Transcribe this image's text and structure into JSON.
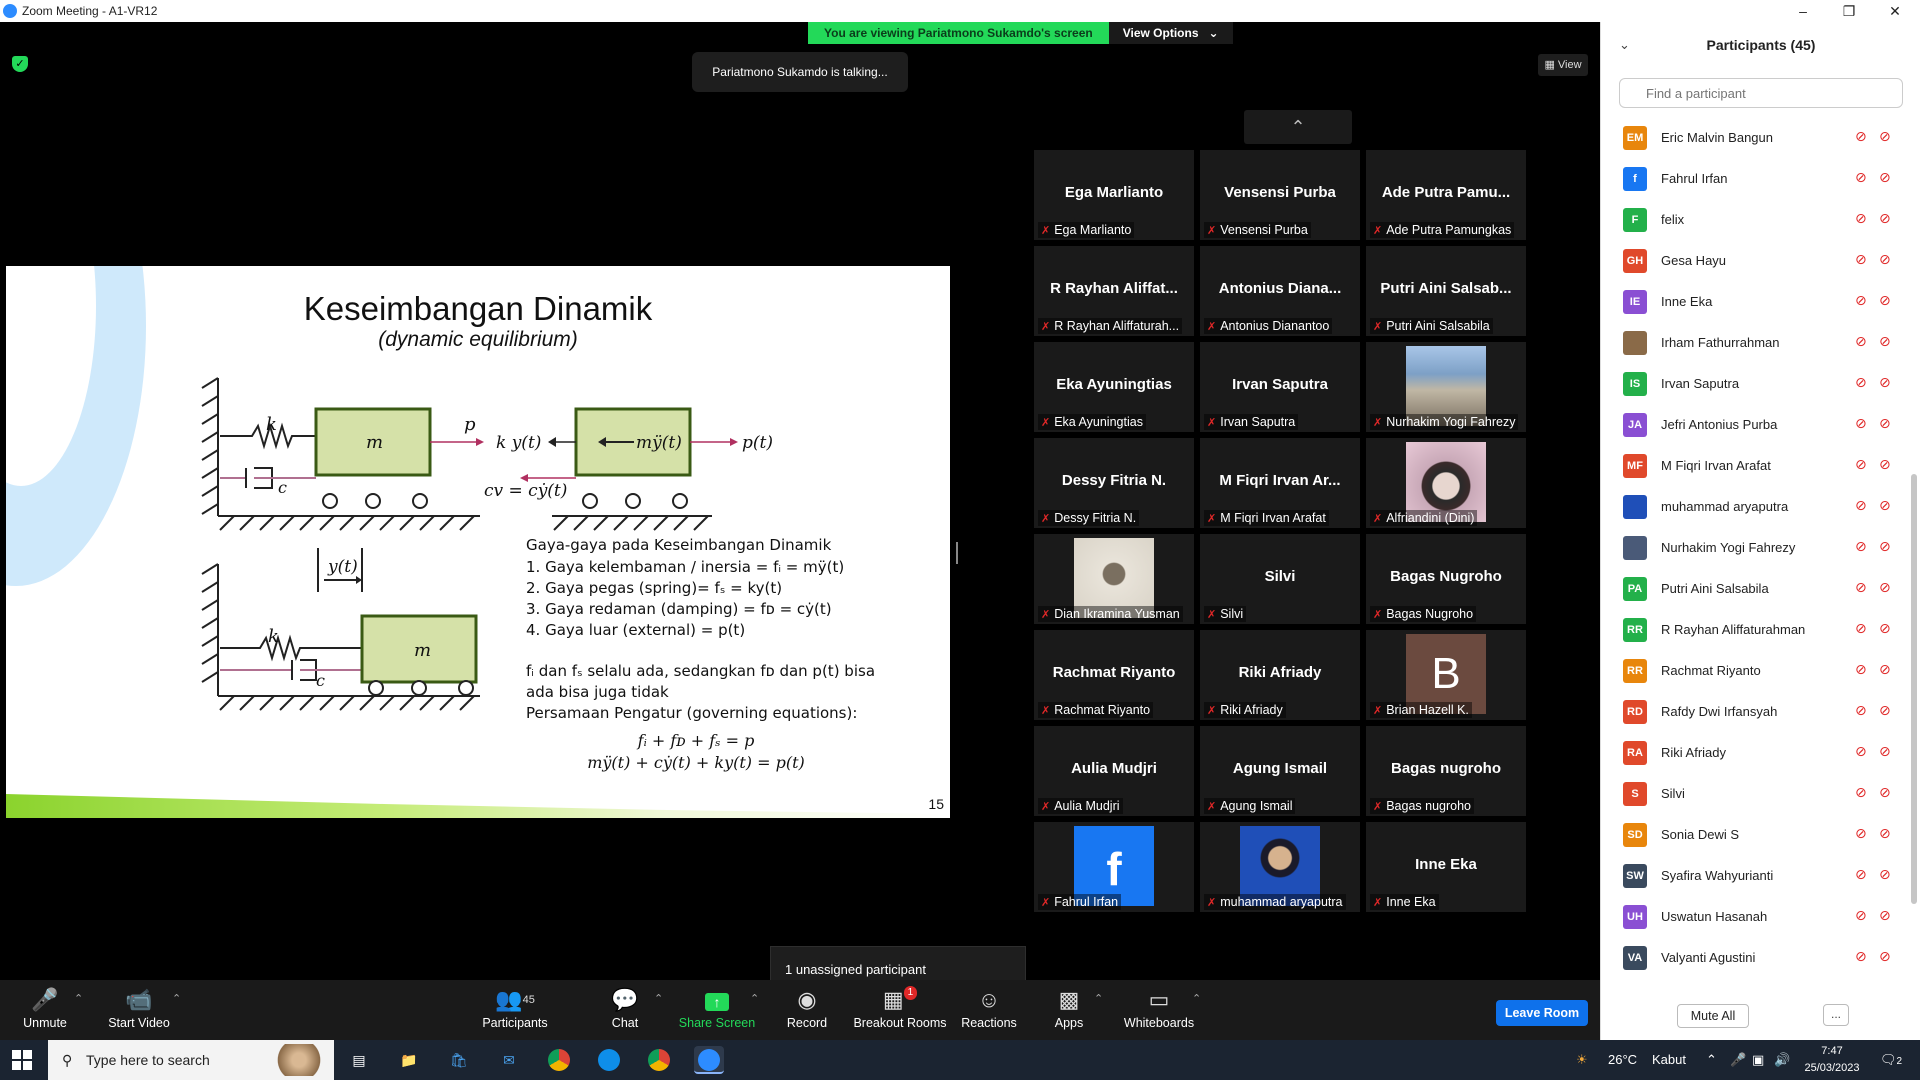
{
  "window": {
    "title": "Zoom Meeting - A1-VR12"
  },
  "banner": {
    "viewing_text": "You are viewing Pariatmono Sukamdo's screen",
    "view_options_label": "View Options"
  },
  "talking_indicator": "Pariatmono Sukamdo is talking...",
  "view_button_label": "View",
  "slide": {
    "title": "Keseimbangan Dinamik",
    "subtitle": "(dynamic equilibrium)",
    "diagram_labels": {
      "k": "k",
      "c": "c",
      "m": "m",
      "p": "p",
      "ky": "k y(t)",
      "my": "mÿ(t)",
      "pt": "p(t)",
      "cv": "cv = cẏ(t)",
      "yt": "y(t)"
    },
    "forces_heading": "Gaya-gaya pada Keseimbangan Dinamik",
    "forces": [
      "1.   Gaya kelembaman / inersia = fᵢ = mÿ(t)",
      "2.   Gaya pegas (spring)= fₛ = ky(t)",
      "3.   Gaya redaman (damping) = fᴅ = cẏ(t)",
      "4.   Gaya luar (external) = p(t)"
    ],
    "note_line1": "fᵢ dan fₛ selalu ada, sedangkan fᴅ dan p(t) bisa",
    "note_line2": "ada bisa juga tidak",
    "governing_heading": "Persamaan Pengatur (governing equations):",
    "equation1": "fᵢ + fᴅ + fₛ = p",
    "equation2": "mÿ(t) + cẏ(t) + ky(t) = p(t)",
    "page_number": "15"
  },
  "video_tiles": [
    {
      "display": "Ega Marlianto",
      "name": "Ega Marlianto"
    },
    {
      "display": "Vensensi Purba",
      "name": "Vensensi Purba"
    },
    {
      "display": "Ade Putra Pamu...",
      "name": "Ade Putra Pamungkas"
    },
    {
      "display": "R Rayhan Aliffat...",
      "name": "R Rayhan Aliffaturah..."
    },
    {
      "display": "Antonius  Diana...",
      "name": "Antonius Dianantoo"
    },
    {
      "display": "Putri Aini Salsab...",
      "name": "Putri Aini Salsabila"
    },
    {
      "display": "Eka Ayuningtias",
      "name": "Eka Ayuningtias"
    },
    {
      "display": "Irvan Saputra",
      "name": "Irvan Saputra"
    },
    {
      "display": "",
      "name": "Nurhakim Yogi Fahrezy"
    },
    {
      "display": "Dessy Fitria N.",
      "name": "Dessy Fitria N."
    },
    {
      "display": "M Fiqri Irvan Ar...",
      "name": "M Fiqri Irvan Arafat"
    },
    {
      "display": "",
      "name": "Alfriandini (Dini)"
    },
    {
      "display": "",
      "name": "Dian Ikramina Yusman"
    },
    {
      "display": "Silvi",
      "name": "Silvi"
    },
    {
      "display": "Bagas Nugroho",
      "name": "Bagas Nugroho"
    },
    {
      "display": "Rachmat Riyanto",
      "name": "Rachmat Riyanto"
    },
    {
      "display": "Riki Afriady",
      "name": "Riki Afriady"
    },
    {
      "display": "B",
      "name": "Brian Hazell K."
    },
    {
      "display": "Aulia Mudjri",
      "name": "Aulia Mudjri"
    },
    {
      "display": "Agung Ismail",
      "name": "Agung Ismail"
    },
    {
      "display": "Bagas nugroho",
      "name": "Bagas nugroho"
    },
    {
      "display": "f",
      "name": "Fahrul Irfan"
    },
    {
      "display": "",
      "name": "muhammad aryaputra"
    },
    {
      "display": "Inne Eka",
      "name": "Inne Eka"
    }
  ],
  "unassigned_text": "1 unassigned participant",
  "toolbar": {
    "unmute": "Unmute",
    "start_video": "Start Video",
    "participants": "Participants",
    "participants_count": "45",
    "chat": "Chat",
    "share_screen": "Share Screen",
    "record": "Record",
    "breakout_rooms": "Breakout Rooms",
    "breakout_badge": "1",
    "reactions": "Reactions",
    "apps": "Apps",
    "whiteboards": "Whiteboards",
    "leave_room": "Leave Room"
  },
  "panel": {
    "header": "Participants (45)",
    "search_placeholder": "Find a participant",
    "participants": [
      {
        "initials": "EM",
        "name": "Eric Malvin Bangun",
        "color": "#e8860c"
      },
      {
        "initials": "f",
        "name": "Fahrul Irfan",
        "color": "#1877f2"
      },
      {
        "initials": "F",
        "name": "felix",
        "color": "#23b04a"
      },
      {
        "initials": "GH",
        "name": "Gesa Hayu",
        "color": "#e0492b"
      },
      {
        "initials": "IE",
        "name": "Inne Eka",
        "color": "#8a4fd3"
      },
      {
        "initials": "",
        "name": "Irham Fathurrahman",
        "color": "#8a6a48"
      },
      {
        "initials": "IS",
        "name": "Irvan Saputra",
        "color": "#23b04a"
      },
      {
        "initials": "JA",
        "name": "Jefri Antonius Purba",
        "color": "#8a4fd3"
      },
      {
        "initials": "MF",
        "name": "M Fiqri Irvan Arafat",
        "color": "#e0492b"
      },
      {
        "initials": "",
        "name": "muhammad aryaputra",
        "color": "#1f4fb8"
      },
      {
        "initials": "",
        "name": "Nurhakim Yogi Fahrezy",
        "color": "#4a5a78"
      },
      {
        "initials": "PA",
        "name": "Putri Aini Salsabila",
        "color": "#23b04a"
      },
      {
        "initials": "RR",
        "name": "R Rayhan Aliffaturahman",
        "color": "#23b04a"
      },
      {
        "initials": "RR",
        "name": "Rachmat Riyanto",
        "color": "#e8860c"
      },
      {
        "initials": "RD",
        "name": "Rafdy Dwi Irfansyah",
        "color": "#e0492b"
      },
      {
        "initials": "RA",
        "name": "Riki Afriady",
        "color": "#e0492b"
      },
      {
        "initials": "S",
        "name": "Silvi",
        "color": "#e0492b"
      },
      {
        "initials": "SD",
        "name": "Sonia Dewi S",
        "color": "#e8860c"
      },
      {
        "initials": "SW",
        "name": "Syafira Wahyurianti",
        "color": "#3a4a5e"
      },
      {
        "initials": "UH",
        "name": "Uswatun Hasanah",
        "color": "#8a4fd3"
      },
      {
        "initials": "VA",
        "name": "Valyanti Agustini",
        "color": "#3a4a5e"
      }
    ],
    "mute_all": "Mute All",
    "more": "..."
  },
  "taskbar": {
    "search_placeholder": "Type here to search",
    "weather_temp": "26°C",
    "weather_desc": "Kabut",
    "time": "7:47",
    "date": "25/03/2023",
    "notification_count": "2"
  }
}
